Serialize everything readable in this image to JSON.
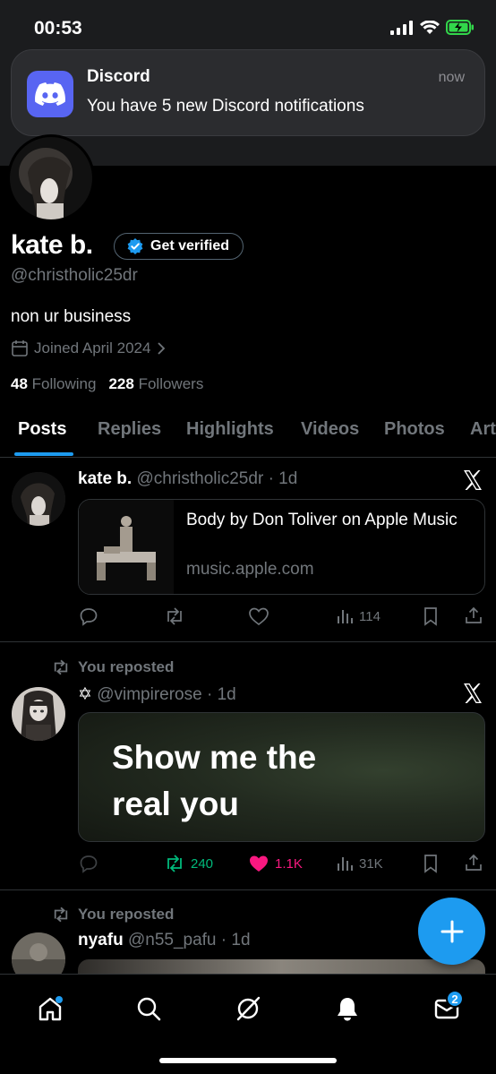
{
  "status_bar": {
    "time": "00:53"
  },
  "notification": {
    "app": "Discord",
    "time": "now",
    "body": "You have 5 new Discord notifications"
  },
  "profile": {
    "name": "kate b.",
    "verify_label": "Get verified",
    "handle": "@christholic25dr",
    "bio": "non ur business",
    "joined": "Joined April 2024",
    "following_count": "48",
    "following_label": "Following",
    "followers_count": "228",
    "followers_label": "Followers"
  },
  "tabs": [
    "Posts",
    "Replies",
    "Highlights",
    "Videos",
    "Photos",
    "Art"
  ],
  "posts": [
    {
      "name": "kate b.",
      "handle": "@christholic25dr",
      "time": "· 1d",
      "card_title": "Body by Don Toliver on Apple Music",
      "card_domain": "music.apple.com",
      "views": "114"
    },
    {
      "repost_label": "You reposted",
      "handle": "@vimpirerose",
      "name_symbol": "✡",
      "time": "· 1d",
      "quote": "Show me the real you",
      "reposts": "240",
      "likes": "1.1K",
      "views": "31K"
    },
    {
      "repost_label": "You reposted",
      "name": "nyafu",
      "handle": "@n55_pafu",
      "time": "· 1d"
    }
  ],
  "bottom_nav": {
    "messages_badge": "2"
  },
  "colors": {
    "accent": "#1d9bf0",
    "like": "#f91880",
    "repost": "#00ba7c",
    "discord": "#5865f2"
  }
}
